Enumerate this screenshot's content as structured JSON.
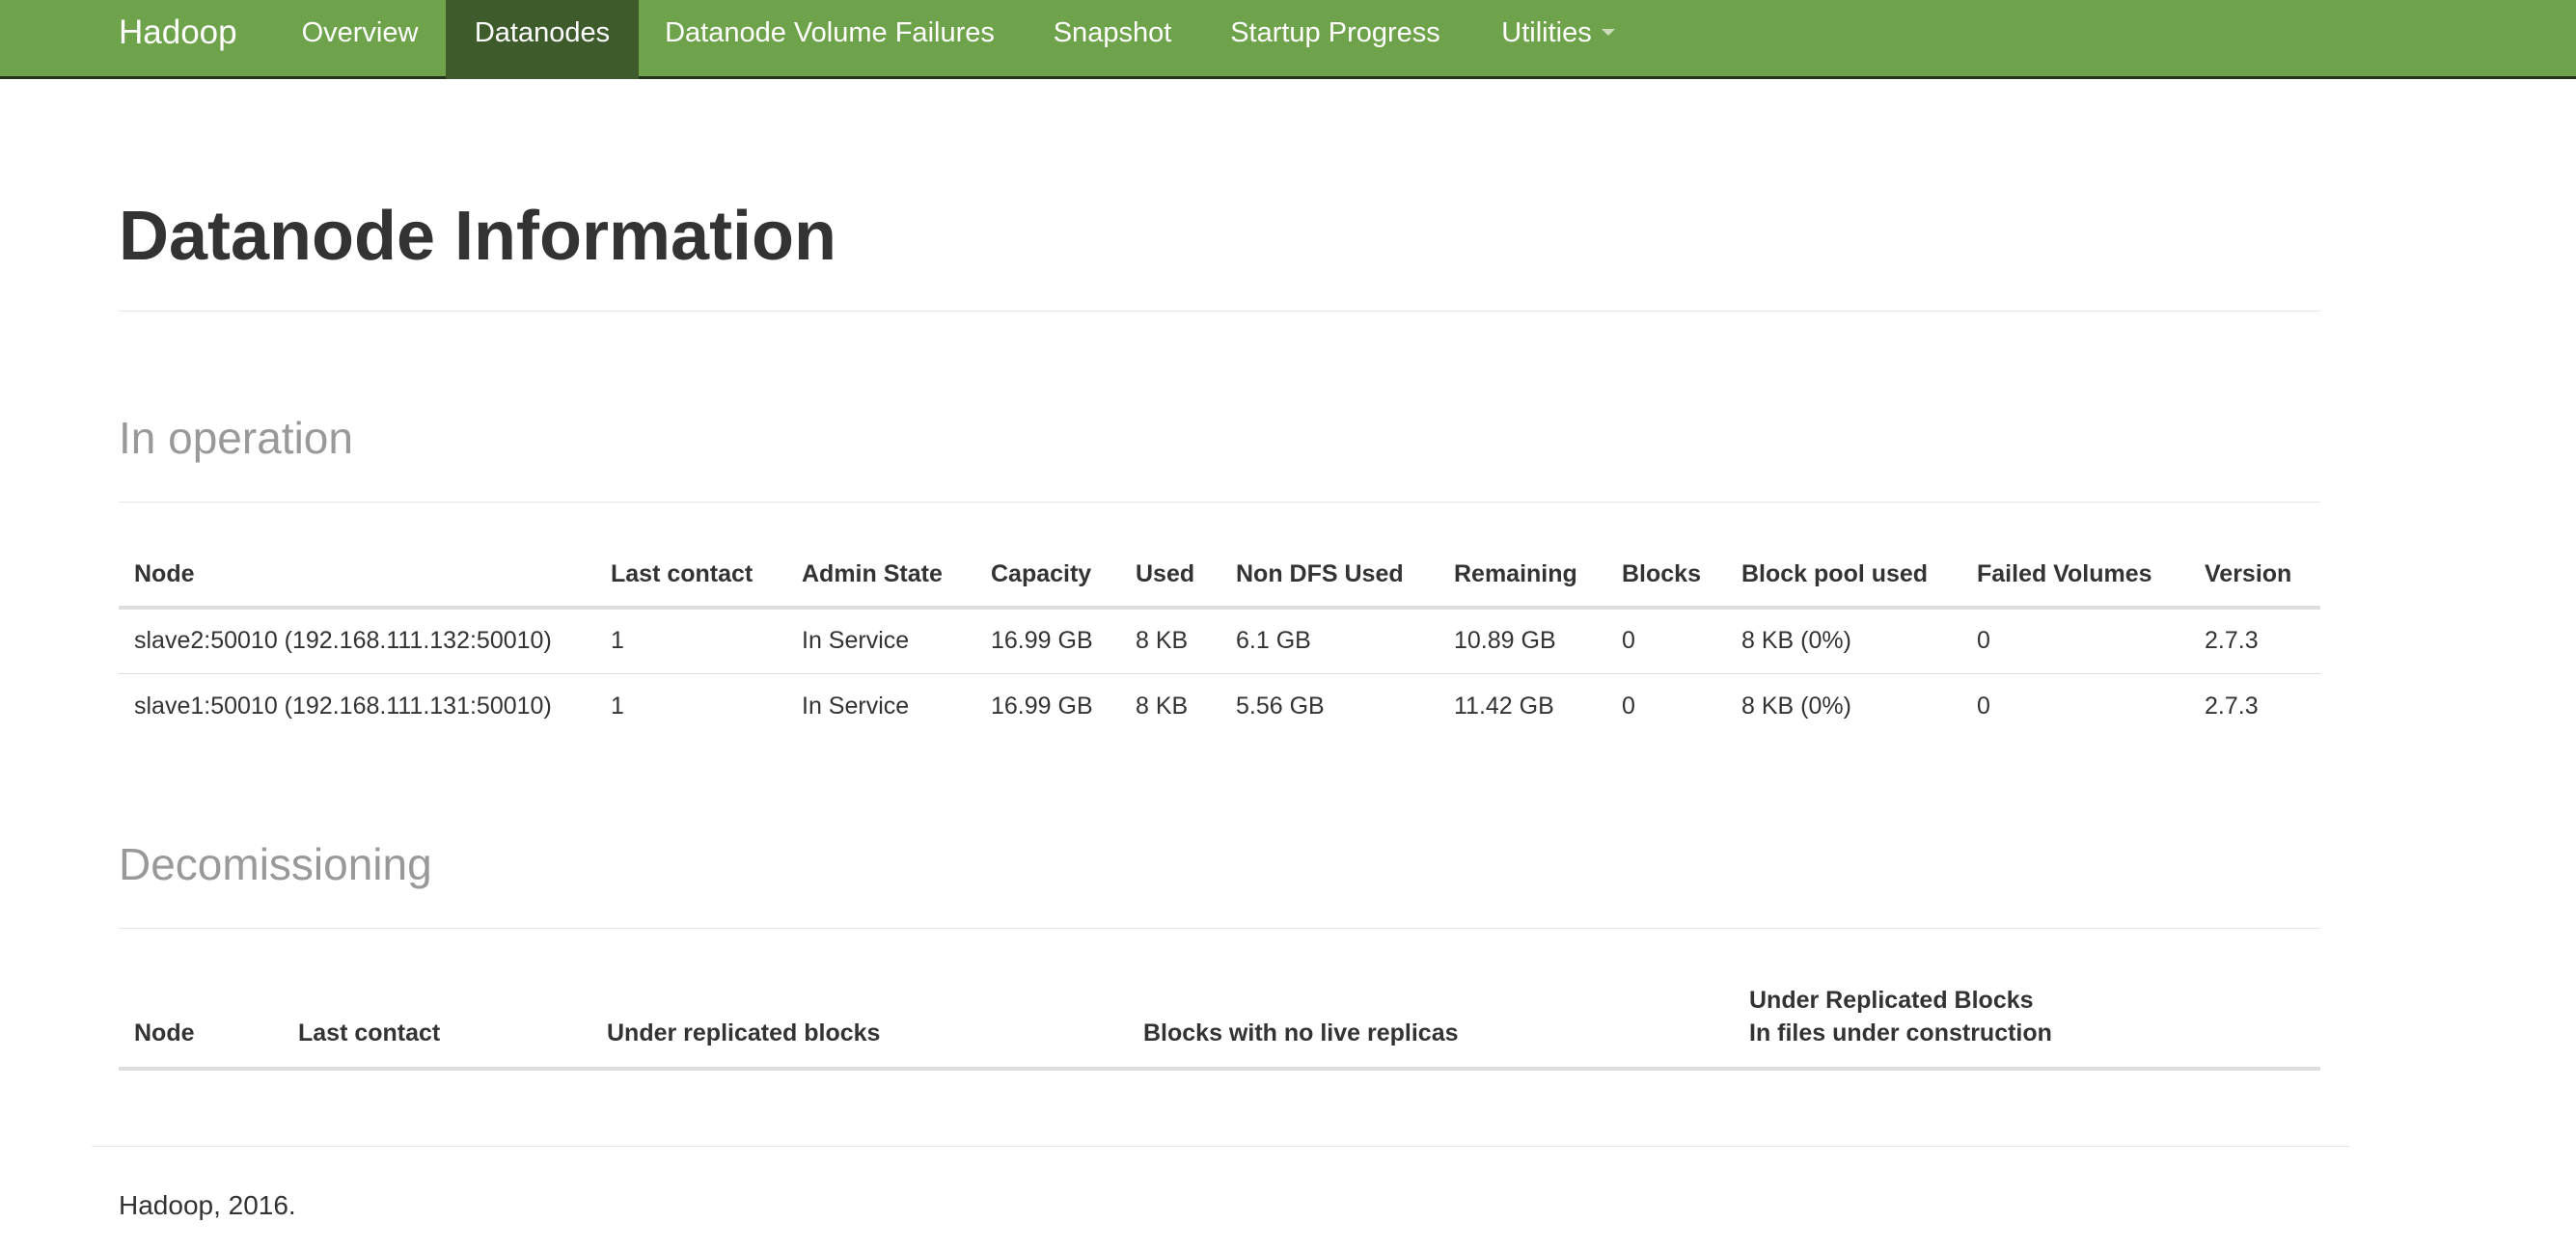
{
  "navbar": {
    "brand": "Hadoop",
    "items": [
      {
        "label": "Overview"
      },
      {
        "label": "Datanodes",
        "active": true
      },
      {
        "label": "Datanode Volume Failures"
      },
      {
        "label": "Snapshot"
      },
      {
        "label": "Startup Progress"
      },
      {
        "label": "Utilities",
        "icon": "caret-down-icon"
      }
    ],
    "colors": {
      "background": "#6ea34b",
      "active": "#3e5b2c",
      "border": "#26331c"
    }
  },
  "page": {
    "title": "Datanode Information"
  },
  "in_operation": {
    "title": "In operation",
    "columns": [
      "Node",
      "Last contact",
      "Admin State",
      "Capacity",
      "Used",
      "Non DFS Used",
      "Remaining",
      "Blocks",
      "Block pool used",
      "Failed Volumes",
      "Version"
    ],
    "rows": [
      [
        "slave2:50010 (192.168.111.132:50010)",
        "1",
        "In Service",
        "16.99 GB",
        "8 KB",
        "6.1 GB",
        "10.89 GB",
        "0",
        "8 KB (0%)",
        "0",
        "2.7.3"
      ],
      [
        "slave1:50010 (192.168.111.131:50010)",
        "1",
        "In Service",
        "16.99 GB",
        "8 KB",
        "5.56 GB",
        "11.42 GB",
        "0",
        "8 KB (0%)",
        "0",
        "2.7.3"
      ]
    ]
  },
  "decommissioning": {
    "title": "Decomissioning",
    "columns": [
      "Node",
      "Last contact",
      "Under replicated blocks",
      "Blocks with no live replicas",
      "Under Replicated Blocks",
      "In files under construction"
    ]
  },
  "footer": {
    "text": "Hadoop, 2016."
  }
}
